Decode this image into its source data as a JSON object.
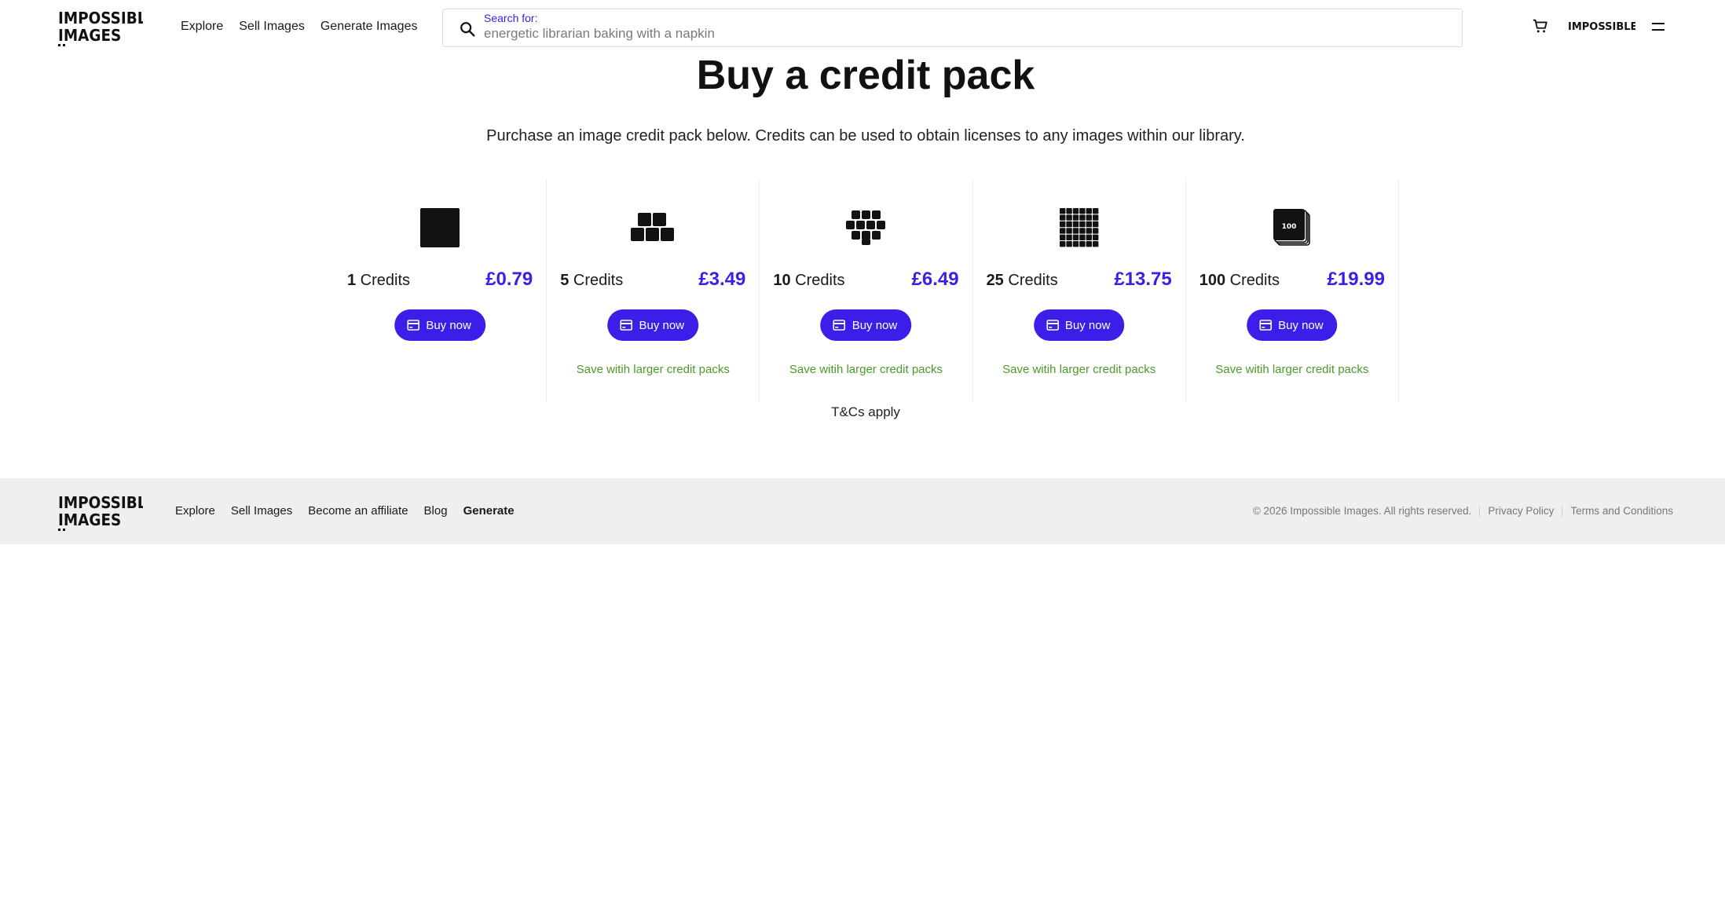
{
  "header": {
    "logo_line1": "IMPOSSIBLE",
    "logo_line2": "IMAGES",
    "nav": [
      "Explore",
      "Sell Images",
      "Generate Images"
    ],
    "search_label": "Search for:",
    "search_placeholder": "energetic librarian baking with a napkin",
    "plus_logo": "IMPOSSIBLE+",
    "icons": [
      "search-icon",
      "cart-icon",
      "menu-icon"
    ]
  },
  "main": {
    "title": "Buy a credit pack",
    "subtitle": "Purchase an image credit pack below. Credits can be used to obtain licenses to any images within our library.",
    "packs": [
      {
        "count": "1",
        "unit": " Credits",
        "price": "£0.79",
        "button": "Buy now",
        "save": "",
        "icon": "single-square-icon"
      },
      {
        "count": "5",
        "unit": " Credits",
        "price": "£3.49",
        "button": "Buy now",
        "save": "Save witih larger credit packs",
        "icon": "five-blocks-icon"
      },
      {
        "count": "10",
        "unit": " Credits",
        "price": "£6.49",
        "button": "Buy now",
        "save": "Save witih larger credit packs",
        "icon": "ten-blocks-icon"
      },
      {
        "count": "25",
        "unit": " Credits",
        "price": "£13.75",
        "button": "Buy now",
        "save": "Save witih larger credit packs",
        "icon": "grid-blocks-icon"
      },
      {
        "count": "100",
        "unit": " Credits",
        "price": "£19.99",
        "button": "Buy now",
        "save": "Save witih larger credit packs",
        "icon": "stack-100-icon",
        "icon_text": "100"
      }
    ],
    "terms": "T&Cs apply"
  },
  "footer": {
    "nav": [
      "Explore",
      "Sell Images",
      "Become an affiliate",
      "Blog",
      "Generate"
    ],
    "copyright": "© 2026 Impossible Images. All rights reserved.",
    "privacy": "Privacy Policy",
    "terms": "Terms and Conditions"
  },
  "colors": {
    "accent": "#3b1ee8",
    "save_green": "#4c9a2a",
    "footer_bg": "#efefef"
  }
}
